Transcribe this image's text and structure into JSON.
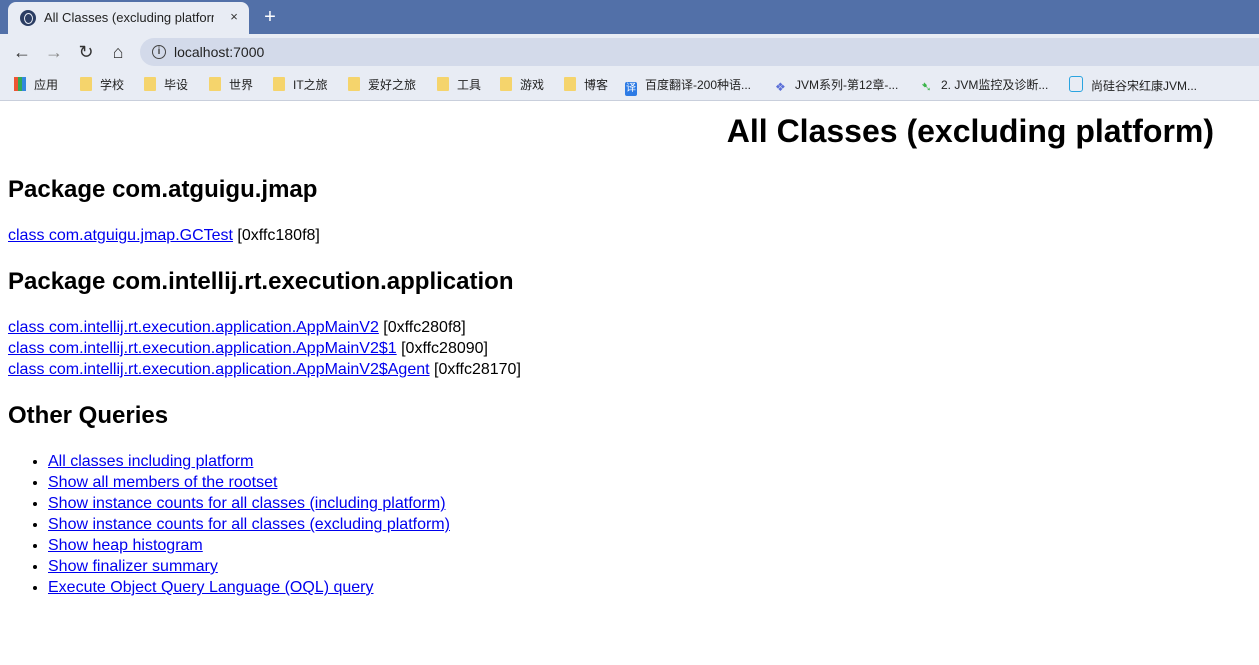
{
  "browser": {
    "tab_title": "All Classes (excluding platform)",
    "tab_close": "×",
    "new_tab": "+",
    "url": "localhost:7000",
    "nav": {
      "back": "←",
      "forward": "→",
      "reload": "↻",
      "home": "⌂"
    },
    "bookmarks": [
      {
        "label": "应用",
        "icon": "apps-grid-icon"
      },
      {
        "label": "学校",
        "icon": "folder-icon"
      },
      {
        "label": "毕设",
        "icon": "folder-icon"
      },
      {
        "label": "世界",
        "icon": "folder-icon"
      },
      {
        "label": "IT之旅",
        "icon": "folder-icon"
      },
      {
        "label": "爱好之旅",
        "icon": "folder-icon"
      },
      {
        "label": "工具",
        "icon": "folder-icon"
      },
      {
        "label": "游戏",
        "icon": "folder-icon"
      },
      {
        "label": "博客",
        "icon": "folder-icon"
      },
      {
        "label": "百度翻译-200种语...",
        "icon": "translate-icon"
      },
      {
        "label": "JVM系列-第12章-...",
        "icon": "site-icon"
      },
      {
        "label": "2. JVM监控及诊断...",
        "icon": "site-icon"
      },
      {
        "label": "尚硅谷宋红康JVM...",
        "icon": "bilibili-icon"
      }
    ]
  },
  "page": {
    "title": "All Classes (excluding platform)",
    "packages": [
      {
        "heading": "Package com.atguigu.jmap",
        "classes": [
          {
            "link": "class com.atguigu.jmap.GCTest",
            "addr": " [0xffc180f8]"
          }
        ]
      },
      {
        "heading": "Package com.intellij.rt.execution.application",
        "classes": [
          {
            "link": "class com.intellij.rt.execution.application.AppMainV2",
            "addr": " [0xffc280f8]"
          },
          {
            "link": "class com.intellij.rt.execution.application.AppMainV2$1",
            "addr": " [0xffc28090]"
          },
          {
            "link": "class com.intellij.rt.execution.application.AppMainV2$Agent",
            "addr": " [0xffc28170]"
          }
        ]
      }
    ],
    "other_heading": "Other Queries",
    "queries": [
      "All classes including platform",
      "Show all members of the rootset",
      "Show instance counts for all classes (including platform)",
      "Show instance counts for all classes (excluding platform)",
      "Show heap histogram",
      "Show finalizer summary",
      "Execute Object Query Language (OQL) query"
    ]
  }
}
